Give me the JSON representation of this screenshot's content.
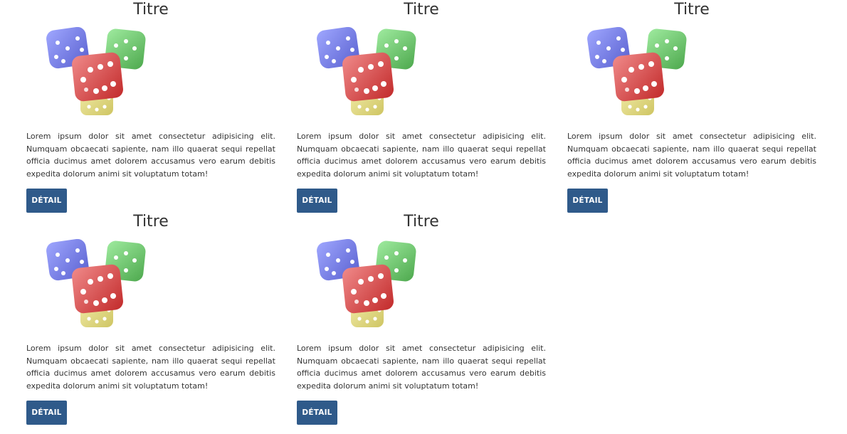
{
  "cards": [
    {
      "title": "Titre",
      "text": "Lorem ipsum dolor sit amet consectetur adipisicing elit. Numquam obcaecati sapiente, nam illo quaerat sequi repellat officia ducimus amet dolorem accusamus vero earum debitis expedita dolorum animi sit voluptatum totam!",
      "button_label": "DÉTAIL",
      "image_icon": "dice-icon"
    },
    {
      "title": "Titre",
      "text": "Lorem ipsum dolor sit amet consectetur adipisicing elit. Numquam obcaecati sapiente, nam illo quaerat sequi repellat officia ducimus amet dolorem accusamus vero earum debitis expedita dolorum animi sit voluptatum totam!",
      "button_label": "DÉTAIL",
      "image_icon": "dice-icon"
    },
    {
      "title": "Titre",
      "text": "Lorem ipsum dolor sit amet consectetur adipisicing elit. Numquam obcaecati sapiente, nam illo quaerat sequi repellat officia ducimus amet dolorem accusamus vero earum debitis expedita dolorum animi sit voluptatum totam!",
      "button_label": "DÉTAIL",
      "image_icon": "dice-icon"
    },
    {
      "title": "Titre",
      "text": "Lorem ipsum dolor sit amet consectetur adipisicing elit. Numquam obcaecati sapiente, nam illo quaerat sequi repellat officia ducimus amet dolorem accusamus vero earum debitis expedita dolorum animi sit voluptatum totam!",
      "button_label": "DÉTAIL",
      "image_icon": "dice-icon"
    },
    {
      "title": "Titre",
      "text": "Lorem ipsum dolor sit amet consectetur adipisicing elit. Numquam obcaecati sapiente, nam illo quaerat sequi repellat officia ducimus amet dolorem accusamus vero earum debitis expedita dolorum animi sit voluptatum totam!",
      "button_label": "DÉTAIL",
      "image_icon": "dice-icon"
    }
  ],
  "colors": {
    "button_bg": "#2f5a8a",
    "button_text": "#ffffff",
    "text": "#333333",
    "die_blue": "#4f5fe0",
    "die_green": "#3fbf3f",
    "die_red": "#e03c3c",
    "die_yellow": "#d8cf4a"
  }
}
